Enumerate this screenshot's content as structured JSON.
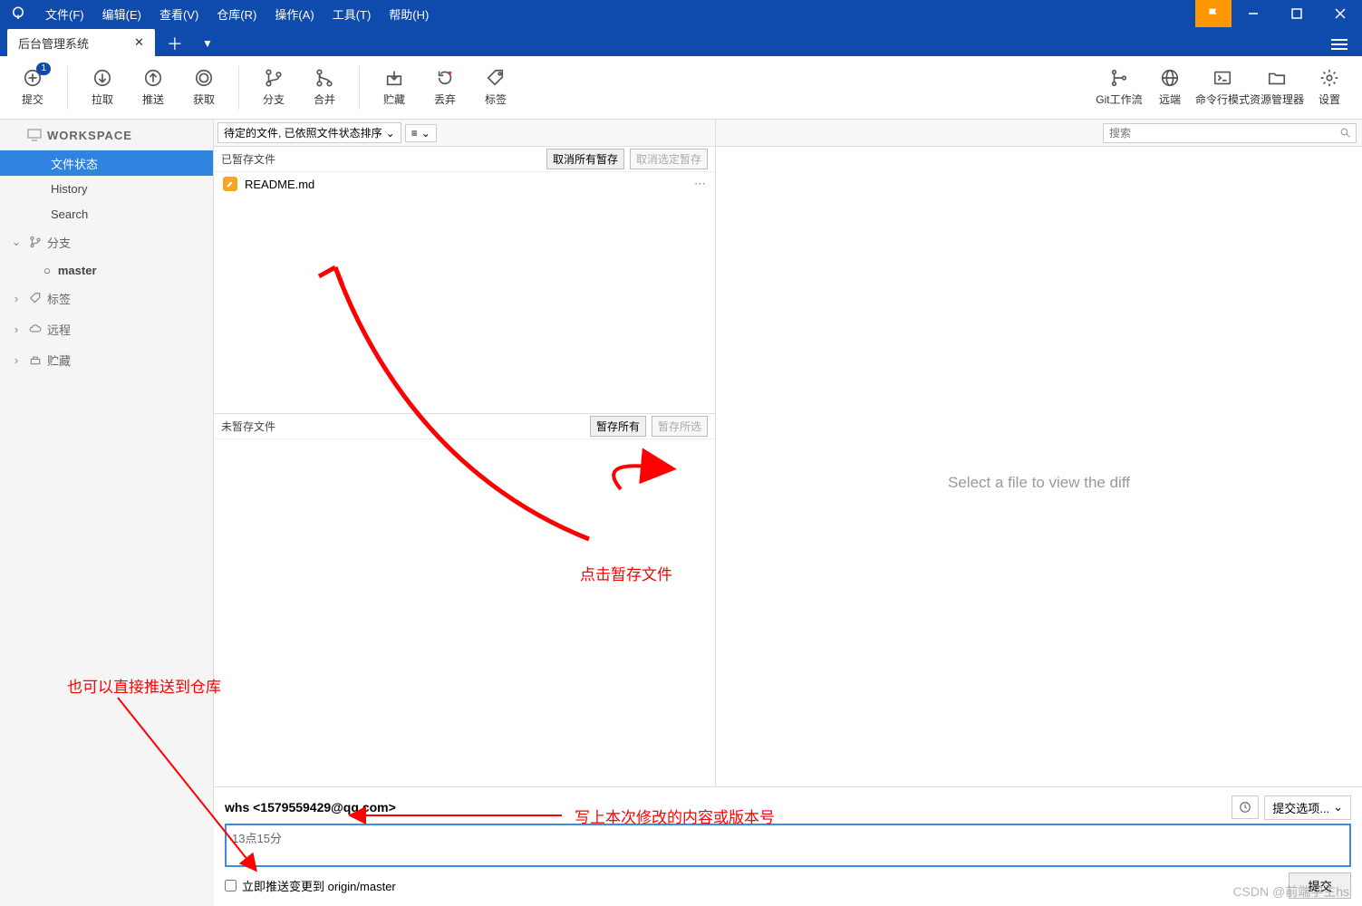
{
  "menubar": {
    "items": [
      "文件(F)",
      "编辑(E)",
      "查看(V)",
      "仓库(R)",
      "操作(A)",
      "工具(T)",
      "帮助(H)"
    ]
  },
  "tab": {
    "title": "后台管理系统"
  },
  "toolbar": {
    "commit": "提交",
    "commit_badge": "1",
    "pull": "拉取",
    "push": "推送",
    "fetch": "获取",
    "branch": "分支",
    "merge": "合并",
    "stash": "贮藏",
    "discard": "丢弃",
    "tag": "标签",
    "gitflow": "Git工作流",
    "remote": "远端",
    "terminal": "命令行模式",
    "explorer": "资源管理器",
    "settings": "设置"
  },
  "sidebar": {
    "workspace": "WORKSPACE",
    "ws_items": [
      "文件状态",
      "History",
      "Search"
    ],
    "branches": "分支",
    "branch_items": [
      "master"
    ],
    "tags": "标签",
    "remote": "远程",
    "stash": "贮藏"
  },
  "filter": {
    "combo": "待定的文件, 已依照文件状态排序"
  },
  "staged": {
    "title": "已暂存文件",
    "unstage_all": "取消所有暂存",
    "unstage_sel": "取消选定暂存",
    "files": [
      "README.md"
    ]
  },
  "unstaged": {
    "title": "未暂存文件",
    "stage_all": "暂存所有",
    "stage_sel": "暂存所选"
  },
  "search": {
    "placeholder": "搜索"
  },
  "diff": {
    "placeholder": "Select a file to view the diff"
  },
  "commit": {
    "author": "whs <1579559429@qq.com>",
    "message": "13点15分",
    "options": "提交选项...",
    "push_label": "立即推送变更到 origin/master",
    "button": "提交"
  },
  "annotations": {
    "a1": "点击暂存文件",
    "a2": "也可以直接推送到仓库",
    "a3": "写上本次修改的内容或版本号"
  },
  "watermark": "CSDN @前端学生hs"
}
